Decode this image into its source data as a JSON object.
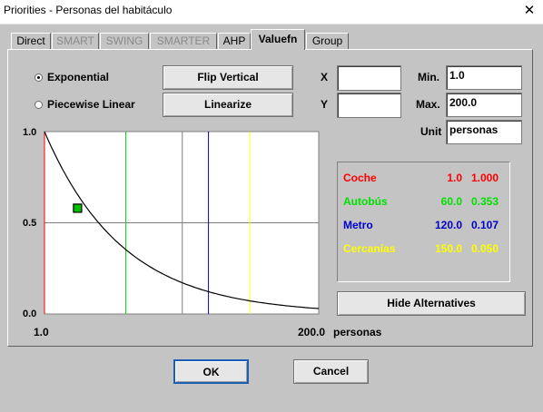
{
  "window": {
    "title": "Priorities - Personas del habitáculo",
    "close": "✕"
  },
  "tabs": [
    {
      "label": "Direct",
      "state": "normal"
    },
    {
      "label": "SMART",
      "state": "disabled"
    },
    {
      "label": "SWING",
      "state": "disabled"
    },
    {
      "label": "SMARTER",
      "state": "disabled"
    },
    {
      "label": "AHP",
      "state": "normal"
    },
    {
      "label": "Valuefn",
      "state": "active"
    },
    {
      "label": "Group",
      "state": "normal"
    }
  ],
  "options": {
    "exponential": "Exponential",
    "piecewise": "Piecewise Linear",
    "selected": "Exponential"
  },
  "buttons": {
    "flip": "Flip Vertical",
    "linearize": "Linearize",
    "hide_alternatives": "Hide Alternatives",
    "ok": "OK",
    "cancel": "Cancel"
  },
  "fields": {
    "x_label": "X",
    "x_value": "",
    "y_label": "Y",
    "y_value": "",
    "min_label": "Min.",
    "min_value": "1.0",
    "max_label": "Max.",
    "max_value": "200.0",
    "unit_label": "Unit",
    "unit_value": "personas"
  },
  "chart_data": {
    "type": "line",
    "curve": "exponential decay",
    "xlim": [
      1.0,
      200.0
    ],
    "ylim": [
      0.0,
      1.0
    ],
    "x_tick_labels": [
      "1.0",
      "200.0"
    ],
    "x_unit": "personas",
    "y_tick_labels": [
      "1.0",
      "0.5",
      "0.0"
    ],
    "gridlines_x": [
      101
    ],
    "gridlines_y": [
      0.5
    ],
    "handle_point": {
      "x": 25,
      "y": 0.58
    },
    "alternatives": [
      {
        "name": "Coche",
        "x": 1.0,
        "value": 1.0,
        "x_text": "1.0",
        "value_text": "1.000",
        "color": "#ff0000"
      },
      {
        "name": "Autobús",
        "x": 60.0,
        "value": 0.353,
        "x_text": "60.0",
        "value_text": "0.353",
        "color": "#00e000"
      },
      {
        "name": "Metro",
        "x": 120.0,
        "value": 0.107,
        "x_text": "120.0",
        "value_text": "0.107",
        "color": "#0000cc"
      },
      {
        "name": "Cercanías",
        "x": 150.0,
        "value": 0.05,
        "x_text": "150.0",
        "value_text": "0.050",
        "color": "#ffff00"
      }
    ]
  },
  "colors": {
    "background": "#c4c4c4",
    "plot_background": "#ffffff",
    "grid": "#808080",
    "curve": "#000000",
    "handle": "#00c000"
  }
}
